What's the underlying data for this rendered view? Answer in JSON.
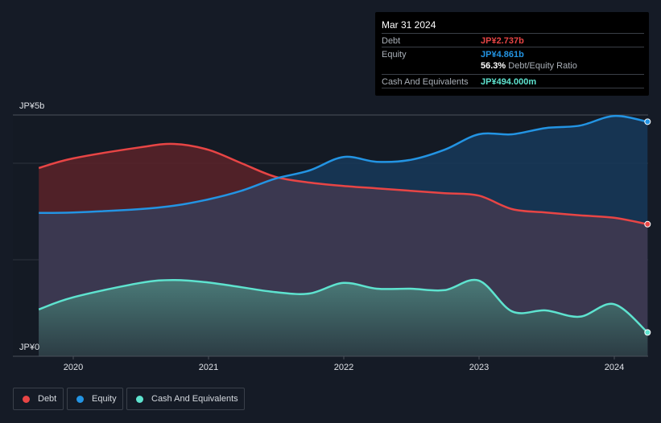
{
  "tooltip": {
    "date": "Mar 31 2024",
    "debt_label": "Debt",
    "debt_value": "JP¥2.737b",
    "equity_label": "Equity",
    "equity_value": "JP¥4.861b",
    "ratio_value": "56.3%",
    "ratio_label": "Debt/Equity Ratio",
    "cash_label": "Cash And Equivalents",
    "cash_value": "JP¥494.000m"
  },
  "legend": [
    {
      "label": "Debt",
      "color": "#e84545"
    },
    {
      "label": "Equity",
      "color": "#2394e3"
    },
    {
      "label": "Cash And Equivalents",
      "color": "#5ee3cf"
    }
  ],
  "chart_data": {
    "type": "area",
    "y_unit": "JP¥ billions",
    "ylim": [
      0,
      5
    ],
    "y_tick_labels": [
      "JP¥5b",
      "JP¥0"
    ],
    "x_tick_labels": [
      "2020",
      "2021",
      "2022",
      "2023",
      "2024"
    ],
    "grid": true,
    "legend_placement": "bottom-left",
    "x": [
      "2019-09-30",
      "2019-12-31",
      "2020-06-30",
      "2020-09-30",
      "2020-12-31",
      "2021-03-31",
      "2021-06-30",
      "2021-09-30",
      "2021-12-31",
      "2022-03-31",
      "2022-06-30",
      "2022-09-30",
      "2022-12-31",
      "2023-03-31",
      "2023-06-30",
      "2023-09-30",
      "2023-12-31",
      "2024-03-31"
    ],
    "series": [
      {
        "name": "Debt",
        "color": "#e84545",
        "values": [
          3.9,
          4.1,
          4.33,
          4.4,
          4.28,
          4.0,
          3.72,
          3.6,
          3.53,
          3.48,
          3.43,
          3.38,
          3.33,
          3.05,
          2.98,
          2.92,
          2.87,
          2.737
        ]
      },
      {
        "name": "Equity",
        "color": "#2394e3",
        "values": [
          2.97,
          2.98,
          3.05,
          3.12,
          3.25,
          3.43,
          3.68,
          3.85,
          4.13,
          4.03,
          4.07,
          4.28,
          4.6,
          4.6,
          4.73,
          4.78,
          4.98,
          4.861
        ]
      },
      {
        "name": "Cash And Equivalents",
        "color": "#5ee3cf",
        "values": [
          0.97,
          1.22,
          1.52,
          1.58,
          1.53,
          1.43,
          1.33,
          1.3,
          1.52,
          1.4,
          1.4,
          1.37,
          1.57,
          0.93,
          0.95,
          0.82,
          1.08,
          0.494
        ]
      }
    ]
  }
}
